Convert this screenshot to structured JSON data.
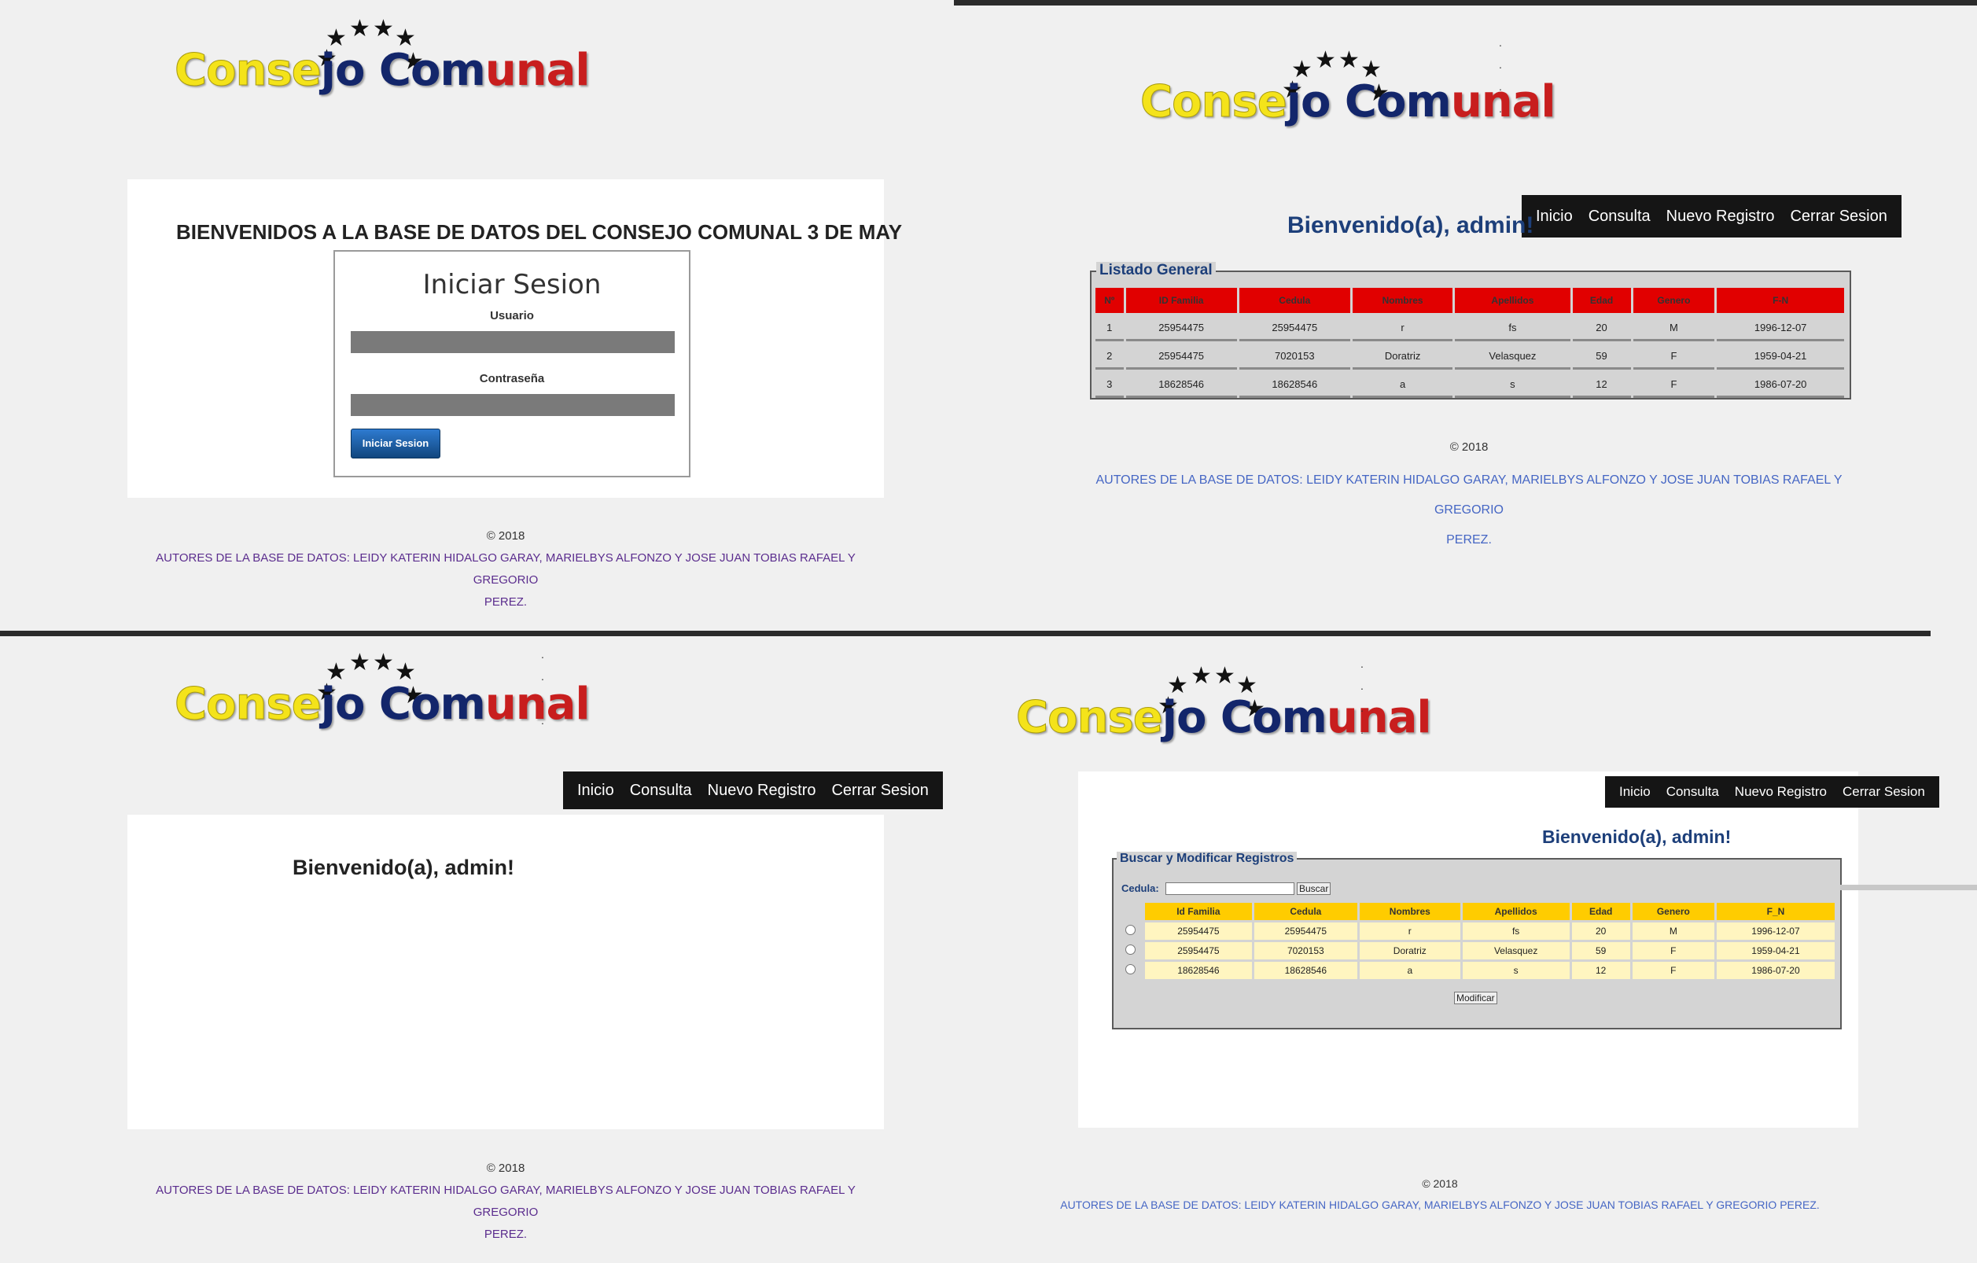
{
  "logo": {
    "part1": "Conse",
    "part2": "jo Com",
    "part3": "unal",
    "stars": [
      "★",
      "★",
      "★",
      "★",
      "★",
      "★"
    ]
  },
  "nav": [
    "Inicio",
    "Consulta",
    "Nuevo Registro",
    "Cerrar Sesion"
  ],
  "login": {
    "title": "BIENVENIDOS A LA BASE DE DATOS DEL CONSEJO COMUNAL 3 DE MAY",
    "heading": "Iniciar Sesion",
    "user_label": "Usuario",
    "pass_label": "Contraseña",
    "button": "Iniciar Sesion"
  },
  "welcome": "Bienvenido(a), admin!",
  "footer": {
    "copy": "© 2018",
    "authors_line1": "AUTORES DE LA BASE DE DATOS: LEIDY KATERIN HIDALGO GARAY, MARIELBYS ALFONZO Y JOSE JUAN TOBIAS RAFAEL Y GREGORIO",
    "authors_line2": "PEREZ.",
    "authors_full": "AUTORES DE LA BASE DE DATOS: LEIDY KATERIN HIDALGO GARAY, MARIELBYS ALFONZO Y JOSE JUAN TOBIAS RAFAEL Y GREGORIO PEREZ.",
    "authors_tr_line1": "AUTORES DE LA BASE DE DATOS: LEIDY KATERIN HIDALGO GARAY, MARIELBYS ALFONZO Y JOSE JUAN TOBIAS RAFAEL Y GREGORIO"
  },
  "listado": {
    "legend": "Listado General",
    "headers": [
      "Nº",
      "ID Familia",
      "Cedula",
      "Nombres",
      "Apellidos",
      "Edad",
      "Genero",
      "F-N"
    ],
    "rows": [
      [
        "1",
        "25954475",
        "25954475",
        "r",
        "fs",
        "20",
        "M",
        "1996-12-07"
      ],
      [
        "2",
        "25954475",
        "7020153",
        "Doratriz",
        "Velasquez",
        "59",
        "F",
        "1959-04-21"
      ],
      [
        "3",
        "18628546",
        "18628546",
        "a",
        "s",
        "12",
        "F",
        "1986-07-20"
      ]
    ]
  },
  "buscar": {
    "legend": "Buscar y Modificar Registros",
    "cedula_label": "Cedula:",
    "search_button": "Buscar",
    "modify_button": "Modificar",
    "headers": [
      "Id Familia",
      "Cedula",
      "Nombres",
      "Apellidos",
      "Edad",
      "Genero",
      "F_N"
    ],
    "rows": [
      [
        "25954475",
        "25954475",
        "r",
        "fs",
        "20",
        "M",
        "1996-12-07"
      ],
      [
        "25954475",
        "7020153",
        "Doratriz",
        "Velasquez",
        "59",
        "F",
        "1959-04-21"
      ],
      [
        "18628546",
        "18628546",
        "a",
        "s",
        "12",
        "F",
        "1986-07-20"
      ]
    ]
  },
  "dots": "."
}
